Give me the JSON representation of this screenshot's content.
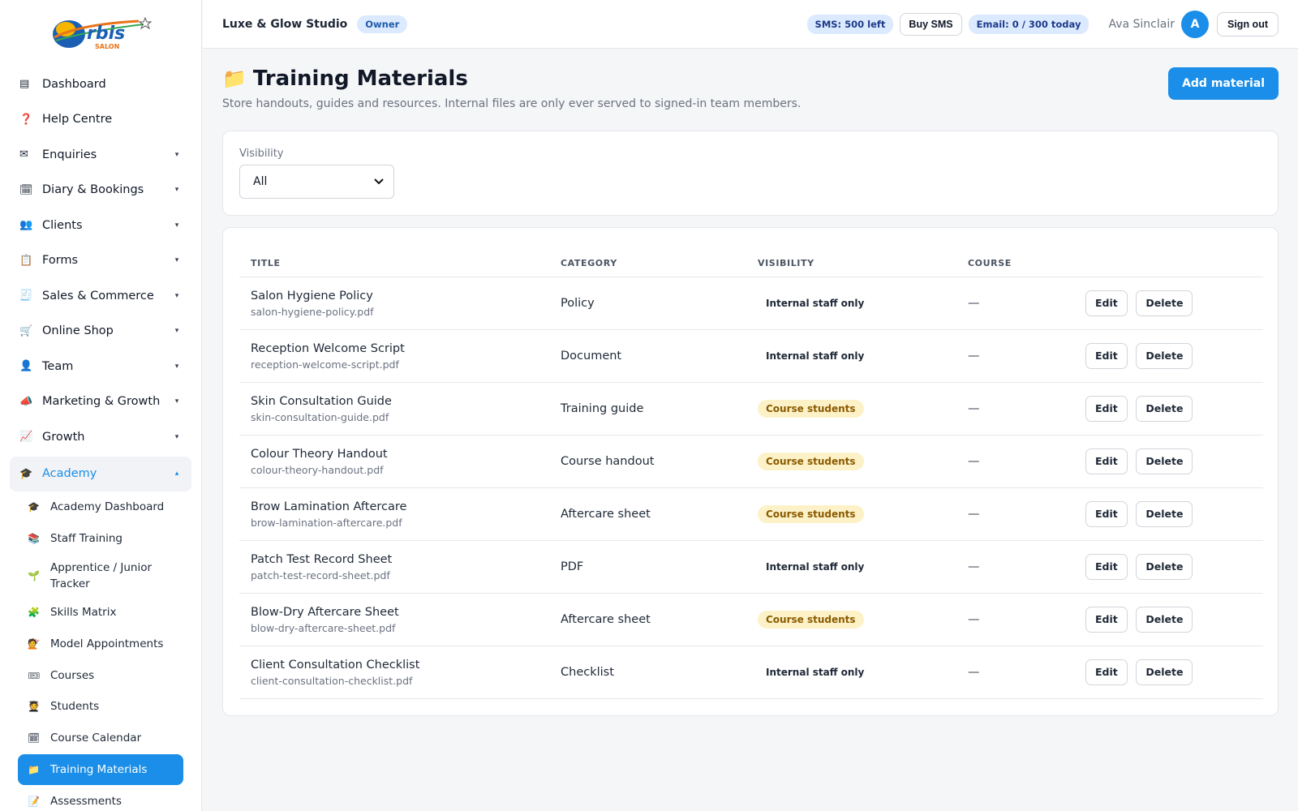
{
  "brand": {
    "logo_text": "rbis",
    "logo_sub": "SALON"
  },
  "sidebar": {
    "items": [
      {
        "label": "Dashboard",
        "icon": "dashboard-icon",
        "glyph": "▤",
        "caret": ""
      },
      {
        "label": "Help Centre",
        "icon": "help-icon",
        "glyph": "❓",
        "caret": ""
      },
      {
        "label": "Enquiries",
        "icon": "mail-icon",
        "glyph": "✉",
        "caret": "▾"
      },
      {
        "label": "Diary & Bookings",
        "icon": "calendar-icon",
        "glyph": "🗓",
        "caret": "▾"
      },
      {
        "label": "Clients",
        "icon": "people-icon",
        "glyph": "👥",
        "caret": "▾"
      },
      {
        "label": "Forms",
        "icon": "clipboard-icon",
        "glyph": "📋",
        "caret": "▾"
      },
      {
        "label": "Sales & Commerce",
        "icon": "receipt-icon",
        "glyph": "🧾",
        "caret": "▾"
      },
      {
        "label": "Online Shop",
        "icon": "cart-icon",
        "glyph": "🛒",
        "caret": "▾"
      },
      {
        "label": "Team",
        "icon": "person-icon",
        "glyph": "👤",
        "caret": "▾"
      },
      {
        "label": "Marketing & Growth",
        "icon": "megaphone-icon",
        "glyph": "📣",
        "caret": "▾"
      },
      {
        "label": "Growth",
        "icon": "chart-up-icon",
        "glyph": "📈",
        "caret": "▾"
      }
    ],
    "academy": {
      "label": "Academy",
      "icon": "graduation-cap-icon",
      "glyph": "🎓",
      "caret": "▴"
    },
    "sub_items": [
      {
        "label": "Academy Dashboard",
        "icon": "graduation-cap-icon",
        "glyph": "🎓"
      },
      {
        "label": "Staff Training",
        "icon": "books-icon",
        "glyph": "📚"
      },
      {
        "label": "Apprentice / Junior Tracker",
        "icon": "seedling-icon",
        "glyph": "🌱"
      },
      {
        "label": "Skills Matrix",
        "icon": "puzzle-icon",
        "glyph": "🧩"
      },
      {
        "label": "Model Appointments",
        "icon": "hairdresser-icon",
        "glyph": "💇"
      },
      {
        "label": "Courses",
        "icon": "ticket-icon",
        "glyph": "🎟"
      },
      {
        "label": "Students",
        "icon": "student-icon",
        "glyph": "🧑‍🎓"
      },
      {
        "label": "Course Calendar",
        "icon": "calendar-icon",
        "glyph": "🗓"
      },
      {
        "label": "Training Materials",
        "icon": "folder-icon",
        "glyph": "📁"
      },
      {
        "label": "Assessments",
        "icon": "memo-icon",
        "glyph": "📝"
      }
    ]
  },
  "topbar": {
    "studio": "Luxe & Glow Studio",
    "role": "Owner",
    "sms": "SMS: 500 left",
    "buy_sms": "Buy SMS",
    "email": "Email: 0 / 300 today",
    "user": "Ava Sinclair",
    "avatar": "A",
    "sign_out": "Sign out"
  },
  "page": {
    "title": "Training Materials",
    "title_icon": "📁",
    "subtitle": "Store handouts, guides and resources. Internal files are only ever served to signed-in team members.",
    "add_button": "Add material"
  },
  "filter": {
    "label": "Visibility",
    "value": "All"
  },
  "table": {
    "headers": [
      "TITLE",
      "CATEGORY",
      "VISIBILITY",
      "COURSE"
    ],
    "edit_label": "Edit",
    "delete_label": "Delete",
    "rows": [
      {
        "title": "Salon Hygiene Policy",
        "file": "salon-hygiene-policy.pdf",
        "category": "Policy",
        "visibility": "Internal staff only",
        "vis_type": "internal",
        "course": "—"
      },
      {
        "title": "Reception Welcome Script",
        "file": "reception-welcome-script.pdf",
        "category": "Document",
        "visibility": "Internal staff only",
        "vis_type": "internal",
        "course": "—"
      },
      {
        "title": "Skin Consultation Guide",
        "file": "skin-consultation-guide.pdf",
        "category": "Training guide",
        "visibility": "Course students",
        "vis_type": "course",
        "course": "—"
      },
      {
        "title": "Colour Theory Handout",
        "file": "colour-theory-handout.pdf",
        "category": "Course handout",
        "visibility": "Course students",
        "vis_type": "course",
        "course": "—"
      },
      {
        "title": "Brow Lamination Aftercare",
        "file": "brow-lamination-aftercare.pdf",
        "category": "Aftercare sheet",
        "visibility": "Course students",
        "vis_type": "course",
        "course": "—"
      },
      {
        "title": "Patch Test Record Sheet",
        "file": "patch-test-record-sheet.pdf",
        "category": "PDF",
        "visibility": "Internal staff only",
        "vis_type": "internal",
        "course": "—"
      },
      {
        "title": "Blow-Dry Aftercare Sheet",
        "file": "blow-dry-aftercare-sheet.pdf",
        "category": "Aftercare sheet",
        "visibility": "Course students",
        "vis_type": "course",
        "course": "—"
      },
      {
        "title": "Client Consultation Checklist",
        "file": "client-consultation-checklist.pdf",
        "category": "Checklist",
        "visibility": "Internal staff only",
        "vis_type": "internal",
        "course": "—"
      }
    ]
  },
  "colors": {
    "accent": "#1a8ee8",
    "course_badge_bg": "#fdf2c7",
    "course_badge_fg": "#8a5a00"
  }
}
